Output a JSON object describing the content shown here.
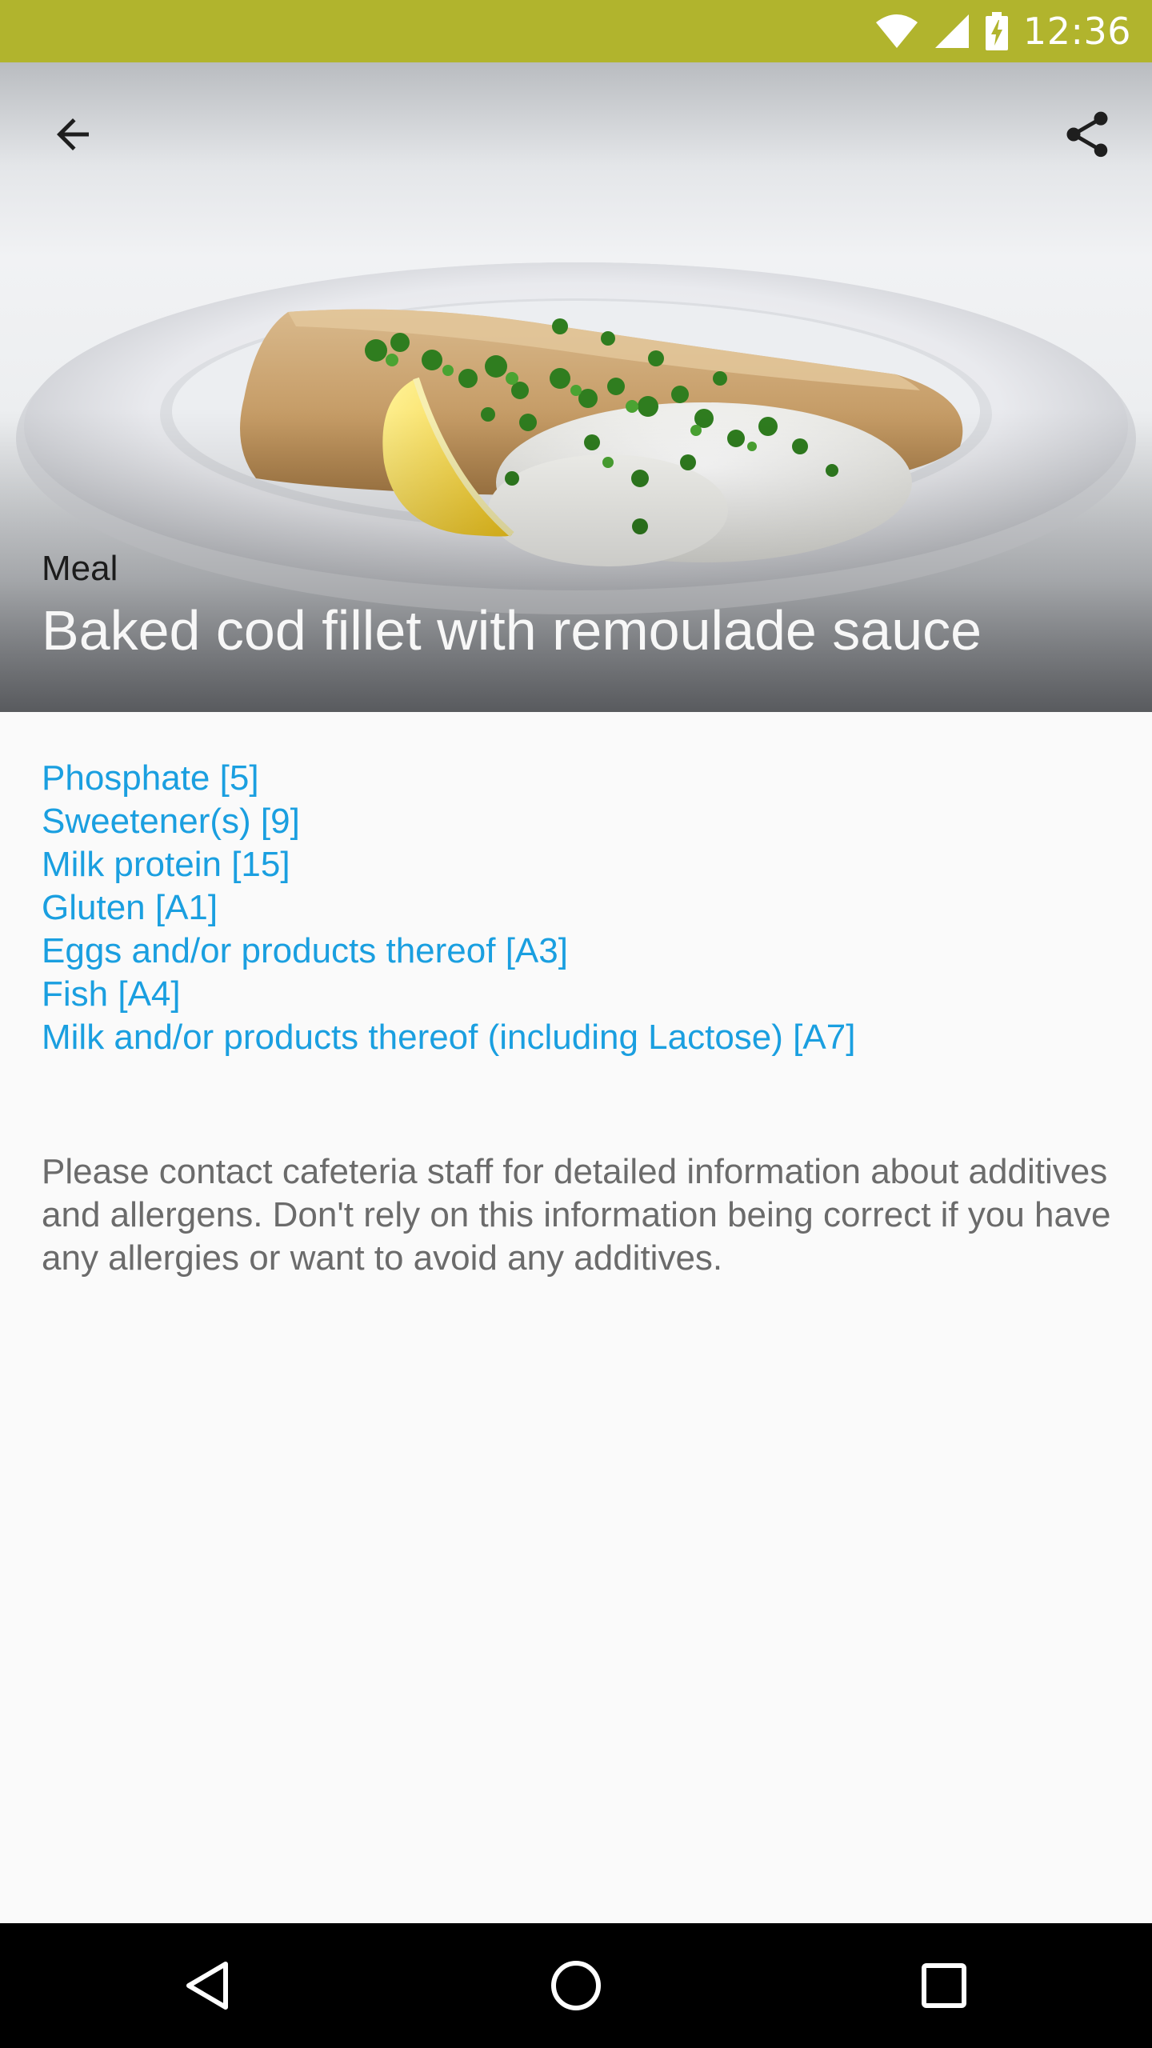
{
  "status_bar": {
    "time": "12:36",
    "icons": [
      "wifi-icon",
      "cell-signal-icon",
      "battery-charging-icon"
    ],
    "color": "#b1b42d"
  },
  "header": {
    "category": "Meal",
    "title": "Baked cod fillet with remoulade sauce",
    "back_icon": "arrow-back-icon",
    "share_icon": "share-icon"
  },
  "additives": [
    "Phosphate [5]",
    "Sweetener(s) [9]",
    "Milk protein [15]",
    "Gluten [A1]",
    "Eggs and/or products thereof [A3]",
    "Fish [A4]",
    "Milk and/or products thereof (including Lactose) [A7]"
  ],
  "disclaimer": "Please contact cafeteria staff for detailed information about additives and allergens. Don't rely on this information being correct if you have any allergies or want to avoid any additives.",
  "nav_bar": {
    "icons": [
      "nav-back-icon",
      "nav-home-icon",
      "nav-recents-icon"
    ]
  },
  "colors": {
    "link": "#1a9fe0",
    "body_text": "#6b6b6b",
    "background": "#fafafa"
  }
}
